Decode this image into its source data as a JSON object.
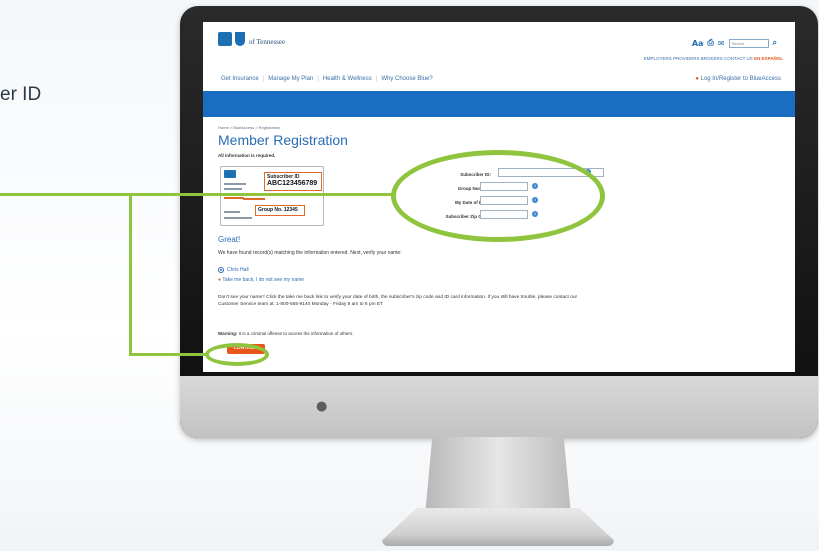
{
  "side_caption": "er ID",
  "site": {
    "logo_text": "of Tennessee",
    "util_icons": [
      "Aa",
      "print-icon",
      "mail-icon"
    ],
    "search_placeholder": "Search",
    "util_links": "EMPLOYERS  PROVIDERS  BROKERS  CONTACT US",
    "espanol_link": "EN ESPAÑOL",
    "nav": [
      "Get Insurance",
      "Manage My Plan",
      "Health & Wellness",
      "Why Choose Blue?"
    ],
    "login_link": "Log In/Register to BlueAccess",
    "brand_color": "#1a6ec2",
    "accent_color": "#e8561b"
  },
  "page": {
    "breadcrumb": "Home > BlueAccess > Registration",
    "title": "Member Registration",
    "required_note": "All information is required.",
    "card": {
      "subscriber_label": "Subscriber ID",
      "subscriber_value": "ABC123456789",
      "group_label": "Group No. 12345"
    },
    "form": {
      "fields": [
        {
          "label": "Subscriber ID:",
          "value": ""
        },
        {
          "label": "Group Number:",
          "value": ""
        },
        {
          "label": "My Date of Birth:",
          "value": ""
        },
        {
          "label": "Subscriber Zip Code:",
          "value": ""
        }
      ]
    },
    "great": "Great!",
    "found_text": "We have found record(s) matching the information entered. Next, verify your name:",
    "radio_name": "Chris Hall",
    "take_back": "Take me back, I do not see my name",
    "help_text": "Don't see your name? Click the take me back link to verify your date of birth, the subscriber's zip code and ID card information. If you still have trouble, please contact our Customer Service team at: 1-800-565-9140 Monday - Friday 8 am to 6 pm ET",
    "warning_label": "Warning:",
    "warning_text": "It is a criminal offense to access the information of others.",
    "continue_label": "CONTINUE"
  },
  "annotation_color": "#8fc43f"
}
